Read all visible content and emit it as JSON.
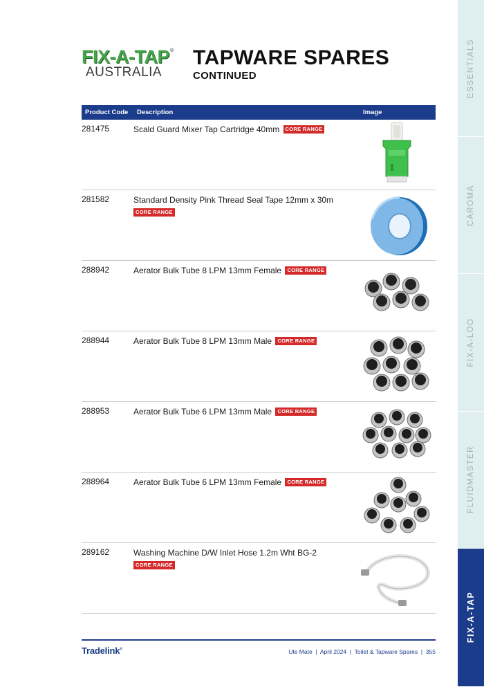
{
  "header": {
    "logo_line1": "FIX-A-TAP",
    "logo_reg": "®",
    "logo_line2": "AUSTRALIA",
    "title": "TAPWARE SPARES",
    "subtitle": "CONTINUED"
  },
  "table": {
    "columns": [
      "Product Code",
      "Description",
      "Image"
    ],
    "rows": [
      {
        "code": "281475",
        "description": "Scald Guard Mixer Tap Cartridge 40mm",
        "badge": "CORE RANGE",
        "image": "tap-cartridge-image"
      },
      {
        "code": "281582",
        "description": "Standard Density Pink Thread Seal Tape 12mm x 30m",
        "badge": "CORE RANGE",
        "image": "thread-seal-tape-image"
      },
      {
        "code": "288942",
        "description": "Aerator Bulk Tube 8 LPM 13mm Female",
        "badge": "CORE RANGE",
        "image": "aerators-image"
      },
      {
        "code": "288944",
        "description": "Aerator Bulk Tube 8 LPM 13mm Male",
        "badge": "CORE RANGE",
        "image": "aerators-image"
      },
      {
        "code": "288953",
        "description": "Aerator Bulk Tube 6 LPM 13mm Male",
        "badge": "CORE RANGE",
        "image": "aerators-image"
      },
      {
        "code": "288964",
        "description": "Aerator Bulk Tube 6 LPM 13mm Female",
        "badge": "CORE RANGE",
        "image": "aerators-image"
      },
      {
        "code": "289162",
        "description": "Washing Machine D/W Inlet Hose 1.2m Wht BG-2",
        "badge": "CORE RANGE",
        "image": "inlet-hose-image"
      }
    ]
  },
  "side_tabs": [
    "ESSENTIALS",
    "CAROMA",
    "FIX-A-LOO",
    "FLUIDMASTER",
    "FIX-A-TAP"
  ],
  "active_tab": "FIX-A-TAP",
  "footer": {
    "brand": "Tradelink",
    "brand_reg": "®",
    "text": "Ute Mate  |  April 2024  |  Toilet & Tapware Spares  |  355"
  },
  "colors": {
    "brand_blue": "#1b3c8a",
    "badge_red": "#d42a2a",
    "logo_green": "#43a54a",
    "tab_inactive": "#dfeeee"
  }
}
